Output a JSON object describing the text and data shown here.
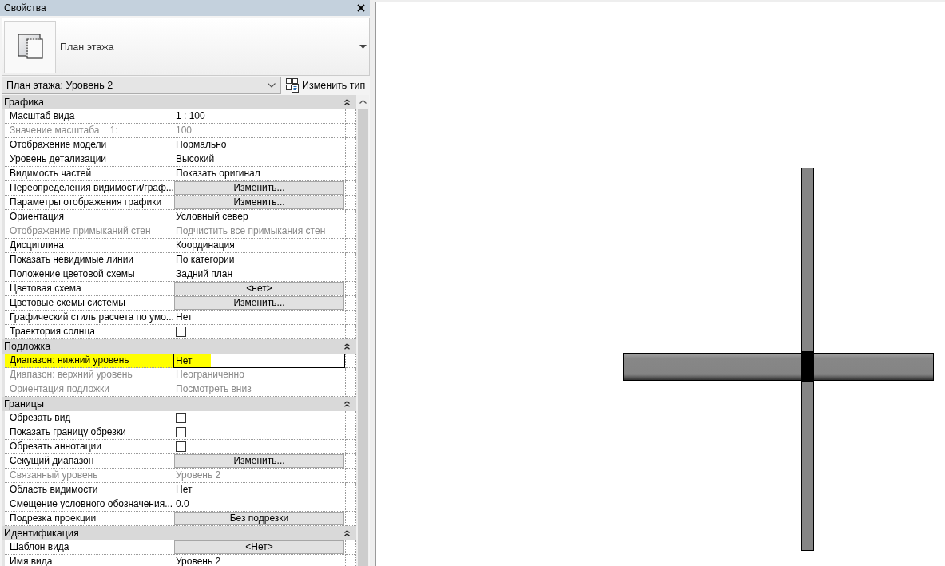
{
  "panel": {
    "title": "Свойства"
  },
  "type_selector": {
    "name": "План этажа"
  },
  "instance_selector": {
    "value": "План этажа: Уровень 2"
  },
  "edit_type_button": {
    "label": "Изменить тип"
  },
  "groups": [
    {
      "title": "Графика",
      "expanded": true,
      "rows": [
        {
          "name": "Масштаб вида",
          "kind": "text",
          "value": "1 : 100",
          "disabled": false,
          "highlighted": false
        },
        {
          "name": "Значение масштаба    1:",
          "kind": "text",
          "value": "100",
          "disabled": true,
          "highlighted": false
        },
        {
          "name": "Отображение модели",
          "kind": "text",
          "value": "Нормально",
          "disabled": false,
          "highlighted": false
        },
        {
          "name": "Уровень детализации",
          "kind": "text",
          "value": "Высокий",
          "disabled": false,
          "highlighted": false
        },
        {
          "name": "Видимость частей",
          "kind": "text",
          "value": "Показать оригинал",
          "disabled": false,
          "highlighted": false
        },
        {
          "name": "Переопределения видимости/граф...",
          "kind": "button",
          "value": "Изменить...",
          "disabled": false,
          "highlighted": false
        },
        {
          "name": "Параметры отображения графики",
          "kind": "button",
          "value": "Изменить...",
          "disabled": false,
          "highlighted": false
        },
        {
          "name": "Ориентация",
          "kind": "text",
          "value": "Условный север",
          "disabled": false,
          "highlighted": false
        },
        {
          "name": "Отображение примыканий стен",
          "kind": "text",
          "value": "Подчистить все примыкания стен",
          "disabled": true,
          "highlighted": false
        },
        {
          "name": "Дисциплина",
          "kind": "text",
          "value": "Координация",
          "disabled": false,
          "highlighted": false
        },
        {
          "name": "Показать невидимые линии",
          "kind": "text",
          "value": "По категории",
          "disabled": false,
          "highlighted": false
        },
        {
          "name": "Положение цветовой схемы",
          "kind": "text",
          "value": "Задний план",
          "disabled": false,
          "highlighted": false
        },
        {
          "name": "Цветовая схема",
          "kind": "button",
          "value": "<нет>",
          "disabled": false,
          "highlighted": false
        },
        {
          "name": "Цветовые схемы системы",
          "kind": "button",
          "value": "Изменить...",
          "disabled": false,
          "highlighted": false
        },
        {
          "name": "Графический стиль расчета по умо...",
          "kind": "text",
          "value": "Нет",
          "disabled": false,
          "highlighted": false
        },
        {
          "name": "Траектория солнца",
          "kind": "checkbox",
          "checked": false,
          "disabled": false,
          "highlighted": false
        }
      ]
    },
    {
      "title": "Подложка",
      "expanded": true,
      "rows": [
        {
          "name": "Диапазон: нижний уровень",
          "kind": "field",
          "value": "Нет",
          "disabled": false,
          "highlighted": true
        },
        {
          "name": "Диапазон: верхний уровень",
          "kind": "text",
          "value": "Неограниченно",
          "disabled": true,
          "highlighted": false
        },
        {
          "name": "Ориентация подложки",
          "kind": "text",
          "value": "Посмотреть вниз",
          "disabled": true,
          "highlighted": false
        }
      ]
    },
    {
      "title": "Границы",
      "expanded": true,
      "rows": [
        {
          "name": "Обрезать вид",
          "kind": "checkbox",
          "checked": false,
          "disabled": false,
          "highlighted": false
        },
        {
          "name": "Показать границу обрезки",
          "kind": "checkbox",
          "checked": false,
          "disabled": false,
          "highlighted": false
        },
        {
          "name": "Обрезать аннотации",
          "kind": "checkbox",
          "checked": false,
          "disabled": false,
          "highlighted": false
        },
        {
          "name": "Секущий диапазон",
          "kind": "button",
          "value": "Изменить...",
          "disabled": false,
          "highlighted": false
        },
        {
          "name": "Связанный уровень",
          "kind": "text",
          "value": "Уровень 2",
          "disabled": true,
          "highlighted": false
        },
        {
          "name": "Область видимости",
          "kind": "text",
          "value": "Нет",
          "disabled": false,
          "highlighted": false
        },
        {
          "name": "Смещение условного обозначения...",
          "kind": "text",
          "value": "0.0",
          "disabled": false,
          "highlighted": false
        },
        {
          "name": "Подрезка проекции",
          "kind": "button",
          "value": "Без подрезки",
          "disabled": false,
          "highlighted": false
        }
      ]
    },
    {
      "title": "Идентификация",
      "expanded": true,
      "rows": [
        {
          "name": "Шаблон вида",
          "kind": "button",
          "value": "<Нет>",
          "disabled": false,
          "highlighted": false
        },
        {
          "name": "Имя вида",
          "kind": "text",
          "value": "Уровень 2",
          "disabled": false,
          "highlighted": false
        }
      ]
    }
  ]
}
